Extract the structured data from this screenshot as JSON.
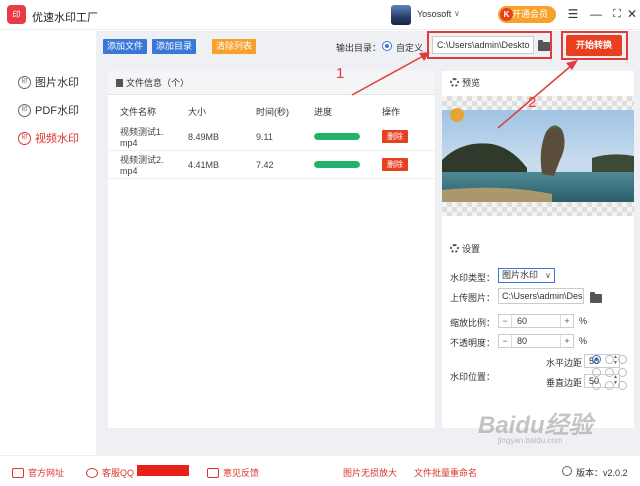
{
  "app": {
    "title": "优速水印工厂",
    "logo_text": "印"
  },
  "user": {
    "name": "Yososoft",
    "vip_label": "开通会员"
  },
  "window_controls": [
    "menu-icon",
    "minimize-icon",
    "maximize-icon",
    "close-icon"
  ],
  "sidebar": {
    "items": [
      {
        "label": "图片水印",
        "icon": "image-watermark-icon",
        "active": false
      },
      {
        "label": "PDF水印",
        "icon": "pdf-watermark-icon",
        "active": false
      },
      {
        "label": "视频水印",
        "icon": "video-watermark-icon",
        "active": true
      }
    ]
  },
  "toolbar": {
    "add_file": "添加文件",
    "add_dir": "添加目录",
    "clear_list": "清除列表",
    "output_label": "输出目录：",
    "custom_label": "自定义",
    "output_path": "C:\\Users\\admin\\Deskto",
    "start_label": "开始转换"
  },
  "file_panel": {
    "header": "文件信息（个）",
    "columns": [
      "文件名称",
      "大小",
      "时间(秒)",
      "进度",
      "操作"
    ],
    "rows": [
      {
        "name_line1": "视频测试1.",
        "name_line2": "mp4",
        "size": "8.49MB",
        "time": "9.11",
        "progress": 1.0,
        "action": "删除"
      },
      {
        "name_line1": "视频测试2.",
        "name_line2": "mp4",
        "size": "4.41MB",
        "time": "7.42",
        "progress": 1.0,
        "action": "删除"
      }
    ]
  },
  "preview": {
    "header": "预览"
  },
  "settings": {
    "header": "设置",
    "type_label": "水印类型：",
    "type_value": "图片水印",
    "upload_label": "上传图片：",
    "upload_path": "C:\\Users\\admin\\Des",
    "scale_label": "缩放比例：",
    "scale_value": "60",
    "opacity_label": "不透明度：",
    "opacity_value": "80",
    "pct": "%",
    "minus": "−",
    "plus": "+",
    "position_label": "水印位置：",
    "h_margin_label": "水平边距",
    "h_margin_value": "50",
    "v_margin_label": "垂直边距",
    "v_margin_value": "50"
  },
  "footer": {
    "website": "官方网址",
    "qq": "客服QQ",
    "feedback": "意见反馈",
    "link1": "图片无损放大",
    "link2": "文件批量重命名",
    "version": "版本：v2.0.2"
  },
  "annotations": {
    "step1": "1",
    "step2": "2"
  },
  "watermark": {
    "text": "Baidu经验",
    "sub": "jingyan.baidu.com"
  },
  "colors": {
    "accent_red": "#e8401f",
    "blue": "#3a78d8",
    "orange": "#f7a12b",
    "progress_green": "#21b36b"
  }
}
